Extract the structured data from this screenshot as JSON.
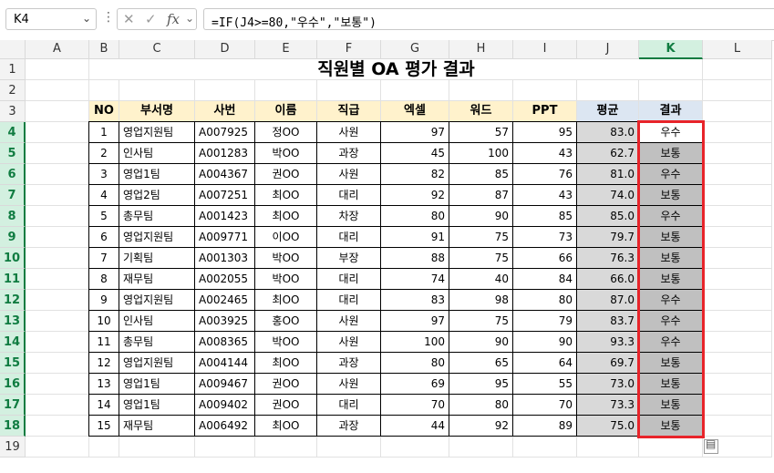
{
  "formula_bar": {
    "name_box": "K4",
    "name_dropdown_icon": "chevron-down-icon",
    "more_icon": "vertical-ellipsis-icon",
    "cancel_icon": "close-icon",
    "enter_icon": "check-icon",
    "fx_label": "fx",
    "formula_dropdown_icon": "chevron-down-icon",
    "formula": "=IF(J4>=80,\"우수\",\"보통\")"
  },
  "columns": [
    "A",
    "B",
    "C",
    "D",
    "E",
    "F",
    "G",
    "H",
    "I",
    "J",
    "K",
    "L"
  ],
  "rows": [
    "1",
    "2",
    "3",
    "4",
    "5",
    "6",
    "7",
    "8",
    "9",
    "10",
    "11",
    "12",
    "13",
    "14",
    "15",
    "16",
    "17",
    "18",
    "19"
  ],
  "selected": {
    "column": "K",
    "row_from": 4,
    "row_to": 18
  },
  "title": "직원별 OA 평가 결과",
  "table": {
    "headers": [
      "NO",
      "부서명",
      "사번",
      "이름",
      "직급",
      "엑셀",
      "워드",
      "PPT",
      "평균",
      "결과"
    ],
    "rows": [
      [
        "1",
        "영업지원팀",
        "A007925",
        "정OO",
        "사원",
        "97",
        "57",
        "95",
        "83.0",
        "우수"
      ],
      [
        "2",
        "인사팀",
        "A001283",
        "박OO",
        "과장",
        "45",
        "100",
        "43",
        "62.7",
        "보통"
      ],
      [
        "3",
        "영업1팀",
        "A004367",
        "권OO",
        "사원",
        "82",
        "85",
        "76",
        "81.0",
        "우수"
      ],
      [
        "4",
        "영업2팀",
        "A007251",
        "최OO",
        "대리",
        "92",
        "87",
        "43",
        "74.0",
        "보통"
      ],
      [
        "5",
        "총무팀",
        "A001423",
        "최OO",
        "차장",
        "80",
        "90",
        "85",
        "85.0",
        "우수"
      ],
      [
        "6",
        "영업지원팀",
        "A009771",
        "이OO",
        "대리",
        "91",
        "75",
        "73",
        "79.7",
        "보통"
      ],
      [
        "7",
        "기획팀",
        "A001303",
        "박OO",
        "부장",
        "88",
        "75",
        "66",
        "76.3",
        "보통"
      ],
      [
        "8",
        "재무팀",
        "A002055",
        "박OO",
        "대리",
        "74",
        "40",
        "84",
        "66.0",
        "보통"
      ],
      [
        "9",
        "영업지원팀",
        "A002465",
        "최OO",
        "대리",
        "83",
        "98",
        "80",
        "87.0",
        "우수"
      ],
      [
        "10",
        "인사팀",
        "A003925",
        "홍OO",
        "사원",
        "97",
        "75",
        "79",
        "83.7",
        "우수"
      ],
      [
        "11",
        "총무팀",
        "A008365",
        "박OO",
        "사원",
        "100",
        "90",
        "90",
        "93.3",
        "우수"
      ],
      [
        "12",
        "영업지원팀",
        "A004144",
        "최OO",
        "과장",
        "80",
        "65",
        "64",
        "69.7",
        "보통"
      ],
      [
        "13",
        "영업1팀",
        "A009467",
        "권OO",
        "사원",
        "69",
        "95",
        "55",
        "73.0",
        "보통"
      ],
      [
        "14",
        "영업1팀",
        "A009402",
        "권OO",
        "대리",
        "70",
        "80",
        "70",
        "73.3",
        "보통"
      ],
      [
        "15",
        "재무팀",
        "A006492",
        "최OO",
        "과장",
        "44",
        "92",
        "89",
        "75.0",
        "보통"
      ]
    ]
  },
  "quick_analysis_icon": "quick-analysis-icon",
  "colors": {
    "header_fill": "#fff2cc",
    "avg_header_fill": "#dce6f2",
    "avg_fill": "#d9d9d9",
    "result_fill": "#c0c0c0",
    "selection_outline": "#e8242a",
    "excel_green": "#107c41"
  }
}
